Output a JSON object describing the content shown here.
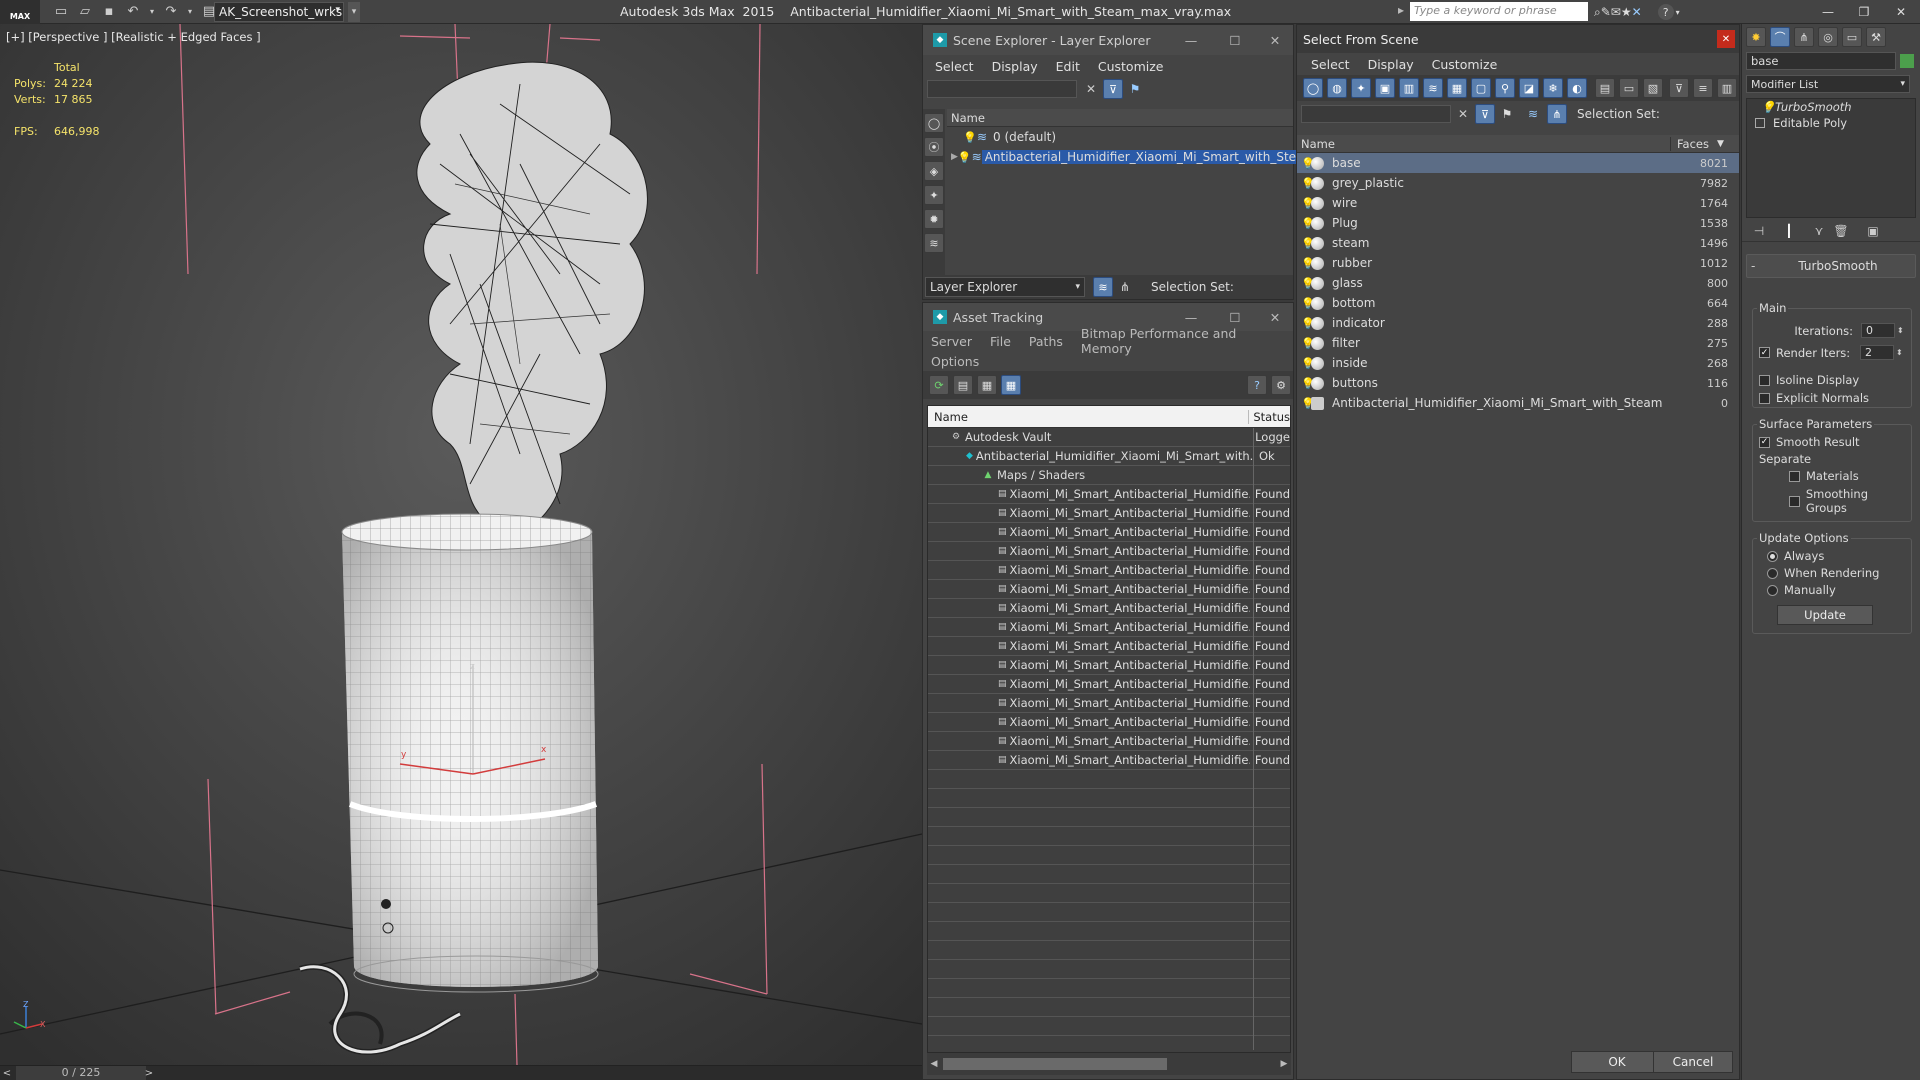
{
  "app": {
    "title": "Autodesk 3ds Max  2015    Antibacterial_Humidifier_Xiaomi_Mi_Smart_with_Steam_max_vray.max",
    "logo": "MAX",
    "workspace": "AK_Screenshot_wrksp",
    "search_placeholder": "Type a keyword or phrase"
  },
  "viewport": {
    "label": "[+] [Perspective ] [Realistic + Edged Faces ]",
    "stats": {
      "total": "Total",
      "polys_label": "Polys:",
      "polys": "24 224",
      "verts_label": "Verts:",
      "verts": "17 865",
      "fps_label": "FPS:",
      "fps": "646,998"
    },
    "gizmo": {
      "z": "z",
      "x": "x",
      "y": "y"
    },
    "axis": {
      "z": "Z",
      "x": "X"
    }
  },
  "timeline": {
    "frame": "0 / 225",
    "prev": "<",
    "next": ">"
  },
  "layer_explorer": {
    "title": "Scene Explorer - Layer Explorer",
    "menu": [
      "Select",
      "Display",
      "Edit",
      "Customize"
    ],
    "column": "Name",
    "rows": [
      {
        "name": "0 (default)"
      },
      {
        "name": "Antibacterial_Humidifier_Xiaomi_Mi_Smart_with_Steam"
      }
    ],
    "footer_label": "Layer Explorer",
    "selection_set": "Selection Set:"
  },
  "asset_tracking": {
    "title": "Asset Tracking",
    "menu": [
      "Server",
      "File",
      "Paths",
      "Bitmap Performance and Memory"
    ],
    "menu2": "Options",
    "columns": [
      "Name",
      "Status"
    ],
    "rows": [
      {
        "name": "Autodesk Vault",
        "status": "Logge",
        "indent": 0
      },
      {
        "name": "Antibacterial_Humidifier_Xiaomi_Mi_Smart_with...",
        "status": "Ok",
        "indent": 1
      },
      {
        "name": "Maps / Shaders",
        "status": "",
        "indent": 2
      },
      {
        "name": "Xiaomi_Mi_Smart_Antibacterial_Humidifie...",
        "status": "Found",
        "indent": 3
      },
      {
        "name": "Xiaomi_Mi_Smart_Antibacterial_Humidifie...",
        "status": "Found",
        "indent": 3
      },
      {
        "name": "Xiaomi_Mi_Smart_Antibacterial_Humidifie...",
        "status": "Found",
        "indent": 3
      },
      {
        "name": "Xiaomi_Mi_Smart_Antibacterial_Humidifie...",
        "status": "Found",
        "indent": 3
      },
      {
        "name": "Xiaomi_Mi_Smart_Antibacterial_Humidifie...",
        "status": "Found",
        "indent": 3
      },
      {
        "name": "Xiaomi_Mi_Smart_Antibacterial_Humidifie...",
        "status": "Found",
        "indent": 3
      },
      {
        "name": "Xiaomi_Mi_Smart_Antibacterial_Humidifie...",
        "status": "Found",
        "indent": 3
      },
      {
        "name": "Xiaomi_Mi_Smart_Antibacterial_Humidifie...",
        "status": "Found",
        "indent": 3
      },
      {
        "name": "Xiaomi_Mi_Smart_Antibacterial_Humidifie...",
        "status": "Found",
        "indent": 3
      },
      {
        "name": "Xiaomi_Mi_Smart_Antibacterial_Humidifie...",
        "status": "Found",
        "indent": 3
      },
      {
        "name": "Xiaomi_Mi_Smart_Antibacterial_Humidifie...",
        "status": "Found",
        "indent": 3
      },
      {
        "name": "Xiaomi_Mi_Smart_Antibacterial_Humidifie...",
        "status": "Found",
        "indent": 3
      },
      {
        "name": "Xiaomi_Mi_Smart_Antibacterial_Humidifie...",
        "status": "Found",
        "indent": 3
      },
      {
        "name": "Xiaomi_Mi_Smart_Antibacterial_Humidifie...",
        "status": "Found",
        "indent": 3
      },
      {
        "name": "Xiaomi_Mi_Smart_Antibacterial_Humidifie...",
        "status": "Found",
        "indent": 3
      }
    ]
  },
  "select_from_scene": {
    "title": "Select From Scene",
    "menu": [
      "Select",
      "Display",
      "Customize"
    ],
    "selection_set": "Selection Set:",
    "columns": [
      "Name",
      "Faces"
    ],
    "rows": [
      {
        "name": "base",
        "faces": "8021"
      },
      {
        "name": "grey_plastic",
        "faces": "7982"
      },
      {
        "name": "wire",
        "faces": "1764"
      },
      {
        "name": "Plug",
        "faces": "1538"
      },
      {
        "name": "steam",
        "faces": "1496"
      },
      {
        "name": "rubber",
        "faces": "1012"
      },
      {
        "name": "glass",
        "faces": "800"
      },
      {
        "name": "bottom",
        "faces": "664"
      },
      {
        "name": "indicator",
        "faces": "288"
      },
      {
        "name": "filter",
        "faces": "275"
      },
      {
        "name": "inside",
        "faces": "268"
      },
      {
        "name": "buttons",
        "faces": "116"
      },
      {
        "name": "Antibacterial_Humidifier_Xiaomi_Mi_Smart_with_Steam",
        "faces": "0"
      }
    ],
    "ok": "OK",
    "cancel": "Cancel"
  },
  "command_panel": {
    "object_name": "base",
    "modifier_list": "Modifier List",
    "stack": [
      "TurboSmooth",
      "Editable Poly"
    ],
    "rollout": "TurboSmooth",
    "main": "Main",
    "iterations_label": "Iterations:",
    "iterations": "0",
    "render_iters_label": "Render Iters:",
    "render_iters": "2",
    "isoline": "Isoline Display",
    "explicit": "Explicit Normals",
    "surface": "Surface Parameters",
    "smooth": "Smooth Result",
    "separate": "Separate",
    "materials": "Materials",
    "smoothing": "Smoothing Groups",
    "update_opts": "Update Options",
    "always": "Always",
    "when_rendering": "When Rendering",
    "manually": "Manually",
    "update": "Update"
  },
  "colors": {
    "accent": "#5c6d86",
    "selected_layer": "#2a5aa8",
    "stats": "#f5e36a",
    "close_red": "#c42b1c"
  }
}
